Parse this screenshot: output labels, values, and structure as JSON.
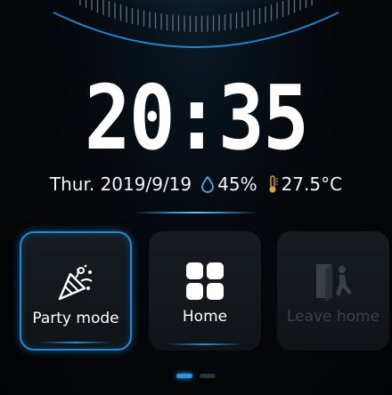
{
  "clock": {
    "time": "20:35"
  },
  "status": {
    "date": "Thur. 2019/9/19",
    "humidity": "45%",
    "temperature": "27.5°C",
    "humidity_icon": "water-drop-icon",
    "temperature_icon": "thermometer-icon"
  },
  "scenes": [
    {
      "label": "Party mode",
      "icon": "party-popper-icon",
      "active": true
    },
    {
      "label": "Home",
      "icon": "home-grid-icon",
      "active": false
    },
    {
      "label": "Leave home",
      "icon": "leave-home-icon",
      "active": false
    }
  ],
  "pager": {
    "pages": 2,
    "current": 1
  },
  "colors": {
    "accent": "#2a95e6",
    "tile_bg": "#14181d",
    "text": "#ffffff",
    "dim_text": "#3c4248"
  }
}
